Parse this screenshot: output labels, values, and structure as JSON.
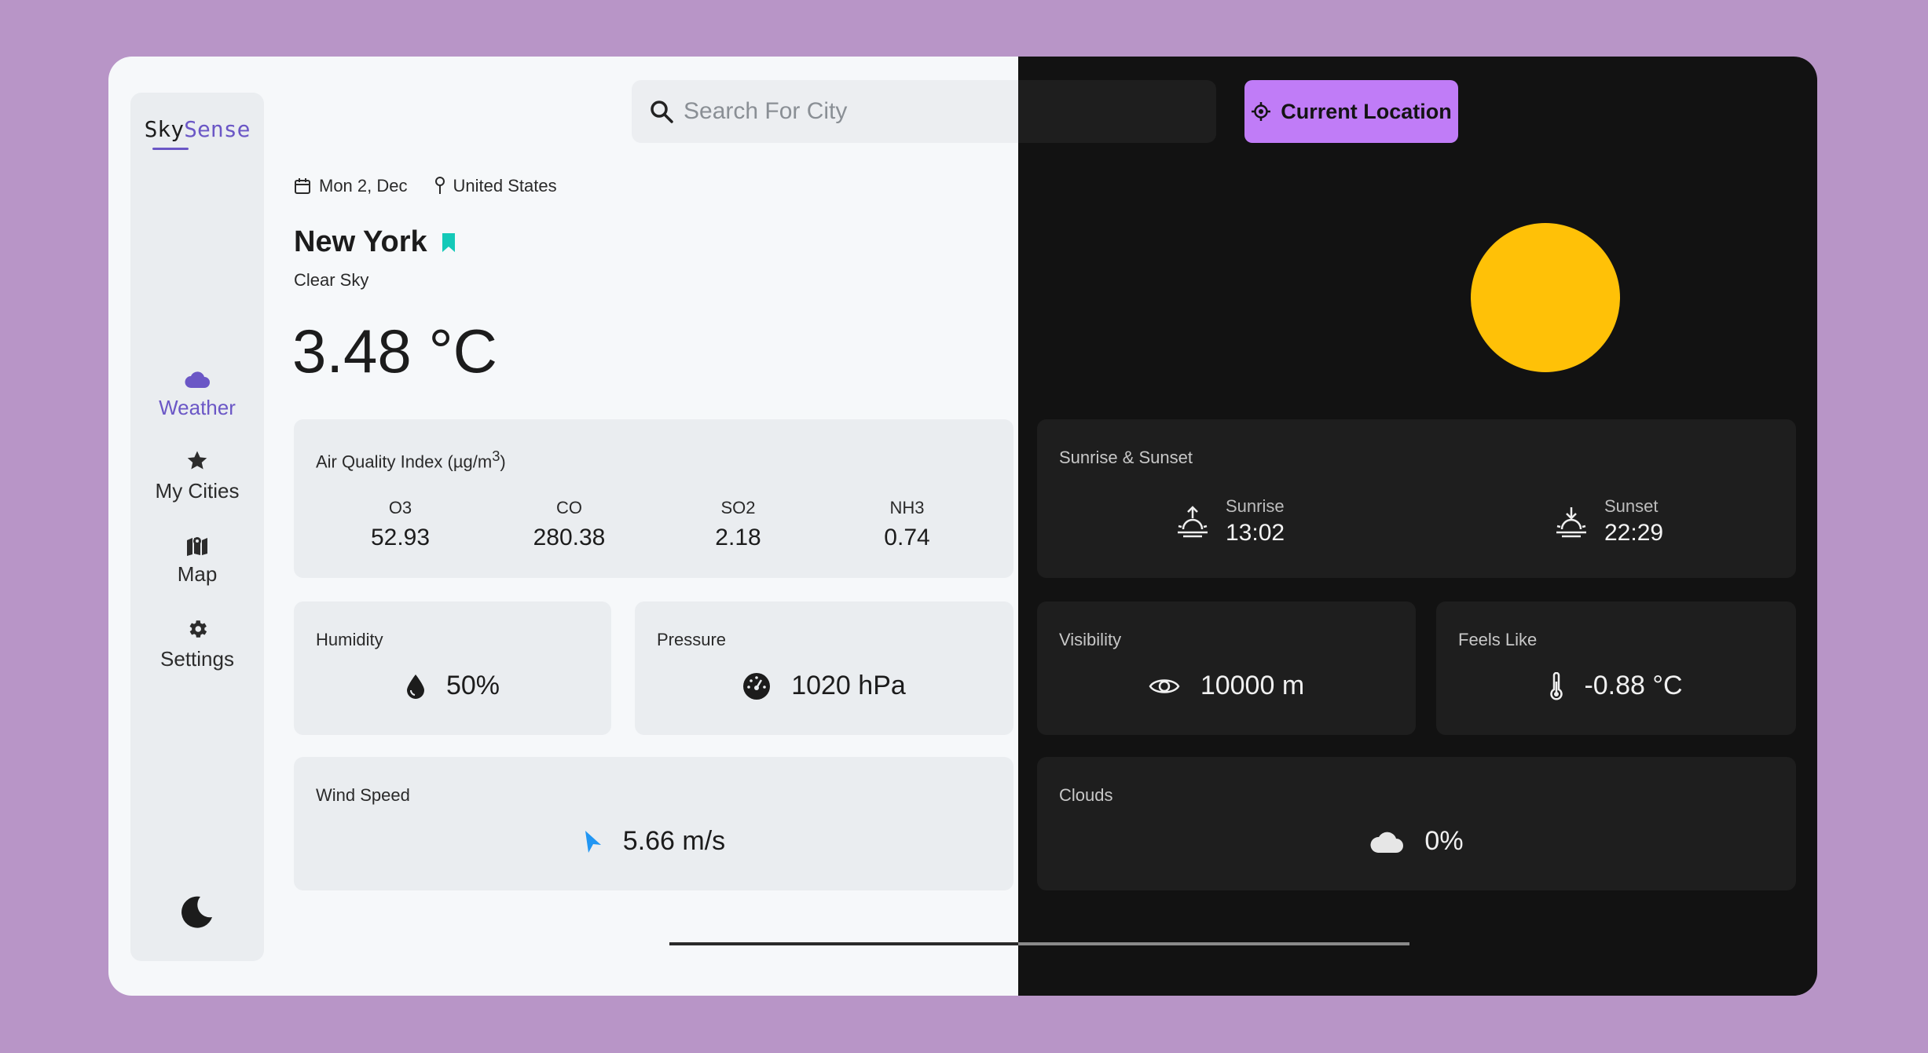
{
  "app": {
    "logo_part1": "Sky",
    "logo_part2": "Sense"
  },
  "sidebar": {
    "items": [
      {
        "label": "Weather",
        "icon": "cloud-icon",
        "active": true
      },
      {
        "label": "My Cities",
        "icon": "star-icon",
        "active": false
      },
      {
        "label": "Map",
        "icon": "map-icon",
        "active": false
      },
      {
        "label": "Settings",
        "icon": "gear-icon",
        "active": false
      }
    ],
    "theme_toggle_icon": "moon-icon"
  },
  "search": {
    "placeholder": "Search For City",
    "value": ""
  },
  "location_button": {
    "label": "Current Location"
  },
  "header": {
    "date": "Mon 2, Dec",
    "country": "United States",
    "city": "New York",
    "condition": "Clear Sky",
    "temperature": "3.48 °C"
  },
  "aqi": {
    "title": "Air Quality Index (µg/m",
    "title_sup": "3",
    "title_end": ")",
    "values": [
      {
        "name": "O3",
        "value": "52.93"
      },
      {
        "name": "CO",
        "value": "280.38"
      },
      {
        "name": "SO2",
        "value": "2.18"
      },
      {
        "name": "NH3",
        "value": "0.74"
      }
    ]
  },
  "sun": {
    "title": "Sunrise & Sunset",
    "sunrise_label": "Sunrise",
    "sunrise_value": "13:02",
    "sunset_label": "Sunset",
    "sunset_value": "22:29"
  },
  "humidity": {
    "title": "Humidity",
    "value": "50%"
  },
  "pressure": {
    "title": "Pressure",
    "value": "1020 hPa"
  },
  "visibility": {
    "title": "Visibility",
    "value": "10000 m"
  },
  "feels_like": {
    "title": "Feels Like",
    "value": "-0.88 °C"
  },
  "wind": {
    "title": "Wind Speed",
    "value": "5.66 m/s"
  },
  "clouds": {
    "title": "Clouds",
    "value": "0%"
  },
  "colors": {
    "accent": "#6b57c6",
    "button": "#c07cf7",
    "sun": "#ffc107",
    "bookmark": "#14c9b8",
    "wind_arrow": "#2196f3",
    "background": "#b895c7"
  }
}
